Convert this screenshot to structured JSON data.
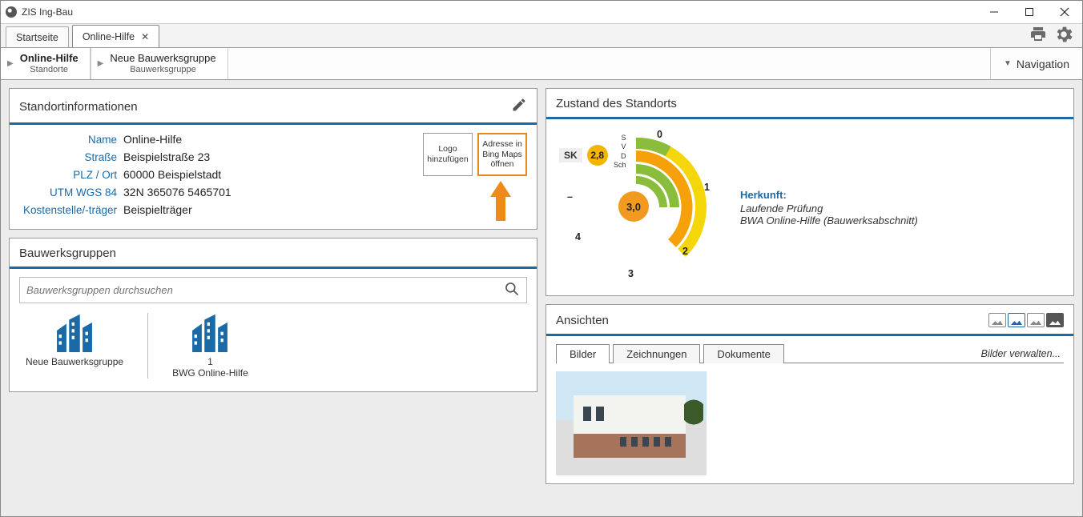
{
  "window": {
    "title": "ZIS Ing-Bau"
  },
  "tabs": [
    "Startseite",
    "Online-Hilfe"
  ],
  "active_tab": 1,
  "toolbar": {
    "print": "print-icon",
    "settings": "gear-icon"
  },
  "breadcrumb": [
    {
      "title": "Online-Hilfe",
      "sub": "Standorte",
      "bold": true
    },
    {
      "title": "Neue Bauwerksgruppe",
      "sub": "Bauwerksgruppe",
      "bold": false
    }
  ],
  "nav_button": "Navigation",
  "cards": {
    "location": {
      "title": "Standortinformationen",
      "fields": {
        "name_lbl": "Name",
        "name_val": "Online-Hilfe",
        "street_lbl": "Straße",
        "street_val": "Beispielstraße 23",
        "plz_lbl": "PLZ / Ort",
        "plz_val": "60000 Beispielstadt",
        "utm_lbl": "UTM WGS 84",
        "utm_val": "32N 365076 5465701",
        "cost_lbl": "Kostenstelle/-träger",
        "cost_val": "Beispielträger"
      },
      "buttons": {
        "logo": "Logo hinzufügen",
        "maps": "Adresse in Bing Maps öffnen"
      }
    },
    "groups": {
      "title": "Bauwerksgruppen",
      "search_placeholder": "Bauwerksgruppen durchsuchen",
      "items": [
        {
          "label": "Neue Bauwerksgruppe",
          "count": ""
        },
        {
          "label": "BWG Online-Hilfe",
          "count": "1"
        }
      ]
    },
    "condition": {
      "title": "Zustand des Standorts",
      "sk_label": "SK",
      "sk_value": "2,8",
      "center_value": "3,0",
      "scale_labels": [
        "0",
        "1",
        "2",
        "3",
        "4",
        "–"
      ],
      "ring_labels": [
        "S",
        "V",
        "D",
        "Sch"
      ],
      "origin_lbl": "Herkunft:",
      "origin_line1": "Laufende Prüfung",
      "origin_line2": "BWA Online-Hilfe (Bauwerksabschnitt)"
    },
    "views": {
      "title": "Ansichten",
      "tabs": [
        "Bilder",
        "Zeichnungen",
        "Dokumente"
      ],
      "active": 0,
      "manage": "Bilder verwalten..."
    }
  },
  "chart_data": {
    "type": "radial-gauge",
    "title": "Zustand des Standorts",
    "scale": {
      "min": 0,
      "max": 4,
      "ticks": [
        "0",
        "1",
        "2",
        "3",
        "4"
      ]
    },
    "center_value": 3.0,
    "sk_value": 2.8,
    "series": [
      {
        "name": "S",
        "value": 1.0,
        "color": "#8bbd3c"
      },
      {
        "name": "V",
        "value": 1.2,
        "color": "#8bbd3c"
      },
      {
        "name": "D",
        "value": 2.0,
        "color": "#f4d60a"
      },
      {
        "name": "Sch",
        "value": 3.0,
        "color": "#f6a10a"
      }
    ]
  }
}
